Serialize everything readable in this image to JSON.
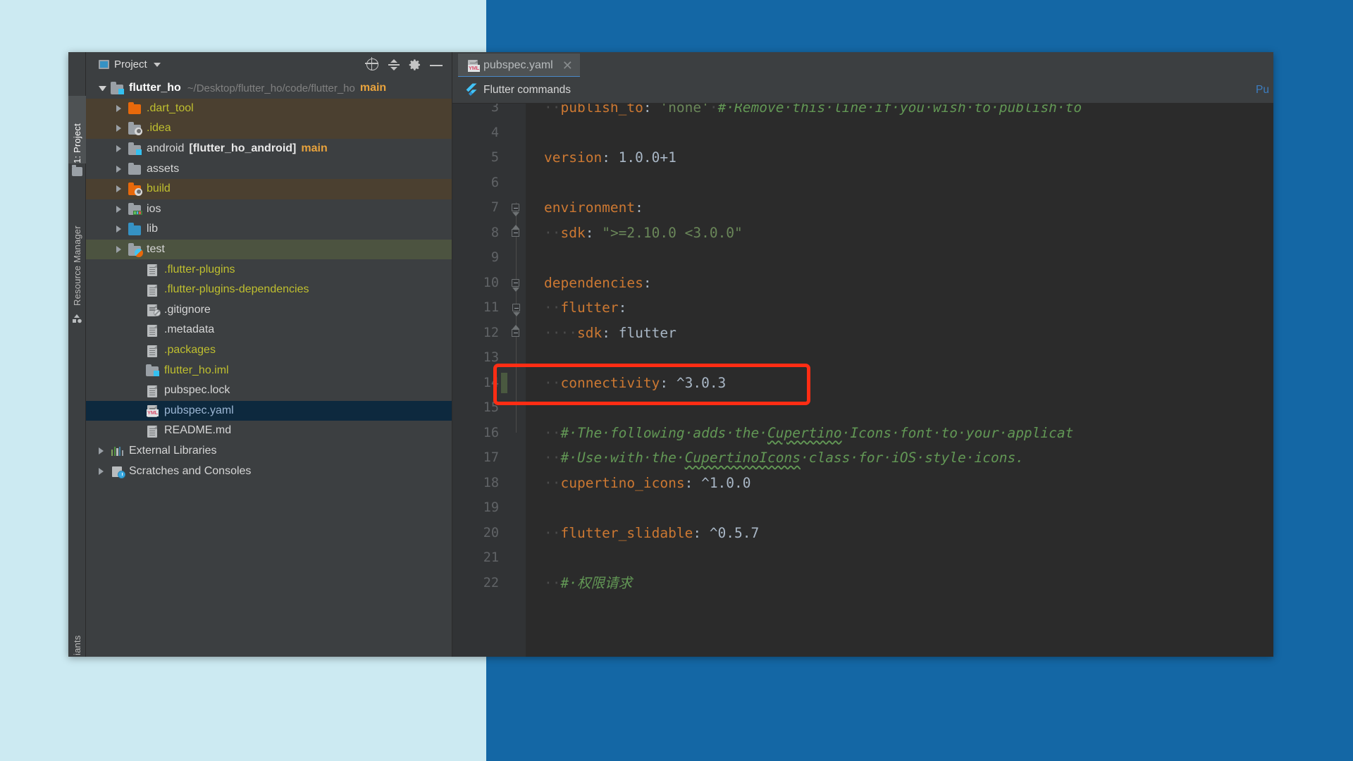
{
  "window": {
    "toolstrip": {
      "project_tab": "1: Project",
      "resource_manager_tab": "Resource Manager",
      "variants_tab": "iants",
      "folder_icon": "folder-icon",
      "resource_icon": "resource-manager-icon"
    },
    "project_panel": {
      "title": "Project",
      "title_icon": "project-view-icon",
      "dropdown_icon": "chevron-down-icon",
      "actions": [
        {
          "name": "select-opened-file-icon",
          "label": "Select Opened File"
        },
        {
          "name": "collapse-all-icon",
          "label": "Collapse All"
        },
        {
          "name": "gear-icon",
          "label": "Settings"
        },
        {
          "name": "minimize-icon",
          "label": "Hide"
        }
      ],
      "tree": [
        {
          "indent": 0,
          "arrow": "down",
          "icon": "folder-module-icon",
          "name": "flutter_ho",
          "style": "bold",
          "path": "~/Desktop/flutter_ho/code/flutter_ho",
          "branch": "main",
          "bg": "none"
        },
        {
          "indent": 1,
          "arrow": "right",
          "icon": "folder-orange-icon",
          "name": ".dart_tool",
          "style": "yellow",
          "bg": "brown"
        },
        {
          "indent": 1,
          "arrow": "right",
          "icon": "folder-idea-icon",
          "name": ".idea",
          "style": "yellow",
          "bg": "brown"
        },
        {
          "indent": 1,
          "arrow": "right",
          "icon": "folder-module-icon",
          "name": "android",
          "style": "white",
          "module": "[flutter_ho_android]",
          "branch": "main",
          "bg": "none"
        },
        {
          "indent": 1,
          "arrow": "right",
          "icon": "folder-grey-icon",
          "name": "assets",
          "style": "white",
          "bg": "none"
        },
        {
          "indent": 1,
          "arrow": "right",
          "icon": "folder-orange-idea-icon",
          "name": "build",
          "style": "yellow",
          "bg": "brown"
        },
        {
          "indent": 1,
          "arrow": "right",
          "icon": "folder-ios-icon",
          "name": "ios",
          "style": "white",
          "bg": "none"
        },
        {
          "indent": 1,
          "arrow": "right",
          "icon": "folder-blue-icon",
          "name": "lib",
          "style": "white",
          "bg": "none"
        },
        {
          "indent": 1,
          "arrow": "right",
          "icon": "folder-dart-test-icon",
          "name": "test",
          "style": "white",
          "bg": "green"
        },
        {
          "indent": 2,
          "arrow": "none",
          "icon": "file-icon",
          "name": ".flutter-plugins",
          "style": "yellow",
          "bg": "none"
        },
        {
          "indent": 2,
          "arrow": "none",
          "icon": "file-icon",
          "name": ".flutter-plugins-dependencies",
          "style": "yellow",
          "bg": "none"
        },
        {
          "indent": 2,
          "arrow": "none",
          "icon": "file-ignored-icon",
          "name": ".gitignore",
          "style": "white",
          "bg": "none"
        },
        {
          "indent": 2,
          "arrow": "none",
          "icon": "file-icon",
          "name": ".metadata",
          "style": "white",
          "bg": "none"
        },
        {
          "indent": 2,
          "arrow": "none",
          "icon": "file-icon",
          "name": ".packages",
          "style": "yellow",
          "bg": "none"
        },
        {
          "indent": 2,
          "arrow": "none",
          "icon": "file-iml-icon",
          "name": "flutter_ho.iml",
          "style": "yellow",
          "bg": "none"
        },
        {
          "indent": 2,
          "arrow": "none",
          "icon": "file-icon",
          "name": "pubspec.lock",
          "style": "white",
          "bg": "none"
        },
        {
          "indent": 2,
          "arrow": "none",
          "icon": "file-yaml-icon",
          "name": "pubspec.yaml",
          "style": "blue",
          "bg": "selected"
        },
        {
          "indent": 2,
          "arrow": "none",
          "icon": "file-icon",
          "name": "README.md",
          "style": "white",
          "bg": "none"
        },
        {
          "indent": 0,
          "arrow": "right",
          "icon": "external-libraries-icon",
          "name": "External Libraries",
          "style": "white",
          "bg": "none"
        },
        {
          "indent": 0,
          "arrow": "right",
          "icon": "scratches-icon",
          "name": "Scratches and Consoles",
          "style": "white",
          "bg": "none"
        }
      ]
    },
    "editor": {
      "tab": {
        "label": "pubspec.yaml",
        "icon": "yaml-file-icon",
        "close_icon": "close-icon",
        "badge": "YML"
      },
      "command_bar": {
        "icon": "flutter-logo-icon",
        "label": "Flutter commands",
        "right_label": "Pu"
      },
      "first_visible_line": 3,
      "lines": [
        {
          "n": 3,
          "fold": "none",
          "text": "  publish_to: 'none' # Remove this line if you wish to publish to",
          "tokens": [
            {
              "t": "  ",
              "c": "dot"
            },
            {
              "t": "publish_to",
              "c": "key"
            },
            {
              "t": ": ",
              "c": "val"
            },
            {
              "t": "'none'",
              "c": "str"
            },
            {
              "t": " ",
              "c": "dot"
            },
            {
              "t": "# Remove this line if you wish to publish to",
              "c": "com"
            }
          ]
        },
        {
          "n": 4,
          "fold": "none",
          "text": "",
          "tokens": []
        },
        {
          "n": 5,
          "fold": "none",
          "text": "  version: 1.0.0+1",
          "tokens": [
            {
              "t": "version",
              "c": "key"
            },
            {
              "t": ": ",
              "c": "val"
            },
            {
              "t": "1.0.0+1",
              "c": "val"
            }
          ]
        },
        {
          "n": 6,
          "fold": "none",
          "text": "",
          "tokens": []
        },
        {
          "n": 7,
          "fold": "start",
          "text": "environment:",
          "tokens": [
            {
              "t": "environment",
              "c": "key"
            },
            {
              "t": ":",
              "c": "val"
            }
          ]
        },
        {
          "n": 8,
          "fold": "end",
          "text": "  sdk: \">=2.10.0 <3.0.0\"",
          "tokens": [
            {
              "t": "  ",
              "c": "dot"
            },
            {
              "t": "sdk",
              "c": "key"
            },
            {
              "t": ": ",
              "c": "val"
            },
            {
              "t": "\">=2.10.0 <3.0.0\"",
              "c": "str"
            }
          ]
        },
        {
          "n": 9,
          "fold": "none",
          "text": "",
          "tokens": []
        },
        {
          "n": 10,
          "fold": "start",
          "text": "dependencies:",
          "tokens": [
            {
              "t": "dependencies",
              "c": "key"
            },
            {
              "t": ":",
              "c": "val"
            }
          ]
        },
        {
          "n": 11,
          "fold": "start2",
          "text": "  flutter:",
          "tokens": [
            {
              "t": "  ",
              "c": "dot"
            },
            {
              "t": "flutter",
              "c": "key"
            },
            {
              "t": ":",
              "c": "val"
            }
          ]
        },
        {
          "n": 12,
          "fold": "end",
          "text": "    sdk: flutter",
          "tokens": [
            {
              "t": "    ",
              "c": "dot"
            },
            {
              "t": "sdk",
              "c": "key"
            },
            {
              "t": ": ",
              "c": "val"
            },
            {
              "t": "flutter",
              "c": "val"
            }
          ]
        },
        {
          "n": 13,
          "fold": "none",
          "text": "",
          "tokens": []
        },
        {
          "n": 14,
          "fold": "none",
          "changed": true,
          "text": "  connectivity: ^3.0.3",
          "tokens": [
            {
              "t": "  ",
              "c": "dot"
            },
            {
              "t": "connectivity",
              "c": "key"
            },
            {
              "t": ": ",
              "c": "val"
            },
            {
              "t": "^3.0.3",
              "c": "val"
            }
          ]
        },
        {
          "n": 15,
          "fold": "none",
          "text": "",
          "tokens": []
        },
        {
          "n": 16,
          "fold": "none",
          "text": "  # The following adds the Cupertino Icons font to your applicat",
          "tokens": [
            {
              "t": "  ",
              "c": "dot"
            },
            {
              "t": "# The following adds the ",
              "c": "com"
            },
            {
              "t": "Cupertino",
              "c": "com-squig"
            },
            {
              "t": " Icons font to your applicat",
              "c": "com"
            }
          ]
        },
        {
          "n": 17,
          "fold": "none",
          "text": "  # Use with the CupertinoIcons class for iOS style icons.",
          "tokens": [
            {
              "t": "  ",
              "c": "dot"
            },
            {
              "t": "# Use with the ",
              "c": "com"
            },
            {
              "t": "CupertinoIcons",
              "c": "com-squig"
            },
            {
              "t": " class for iOS style icons.",
              "c": "com"
            }
          ]
        },
        {
          "n": 18,
          "fold": "none",
          "text": "  cupertino_icons: ^1.0.0",
          "tokens": [
            {
              "t": "  ",
              "c": "dot"
            },
            {
              "t": "cupertino_icons",
              "c": "key"
            },
            {
              "t": ": ",
              "c": "val"
            },
            {
              "t": "^1.0.0",
              "c": "val"
            }
          ]
        },
        {
          "n": 19,
          "fold": "none",
          "text": "",
          "tokens": []
        },
        {
          "n": 20,
          "fold": "none",
          "text": "  flutter_slidable: ^0.5.7",
          "tokens": [
            {
              "t": "  ",
              "c": "dot"
            },
            {
              "t": "flutter_slidable",
              "c": "key"
            },
            {
              "t": ": ",
              "c": "val"
            },
            {
              "t": "^0.5.7",
              "c": "val"
            }
          ]
        },
        {
          "n": 21,
          "fold": "none",
          "text": "",
          "tokens": []
        },
        {
          "n": 22,
          "fold": "none",
          "text": "  # 权限请求",
          "tokens": [
            {
              "t": "  ",
              "c": "dot"
            },
            {
              "t": "# 权限请求",
              "c": "com"
            }
          ]
        }
      ],
      "annotation": {
        "target_line": 14,
        "color": "#ff2d14",
        "shape": "rounded-rect"
      }
    }
  },
  "colors": {
    "background_left": "#cceaf2",
    "background_right": "#1467a5",
    "ide_chrome": "#3c3f41",
    "editor_background": "#2b2b2b",
    "gutter": "#313335",
    "selection": "#0d293e",
    "accent_tab": "#4a88c7",
    "annotation": "#ff2d14",
    "keyword": "#cc7832",
    "string": "#6a8759",
    "comment": "#629755",
    "value": "#a9b7c6"
  }
}
